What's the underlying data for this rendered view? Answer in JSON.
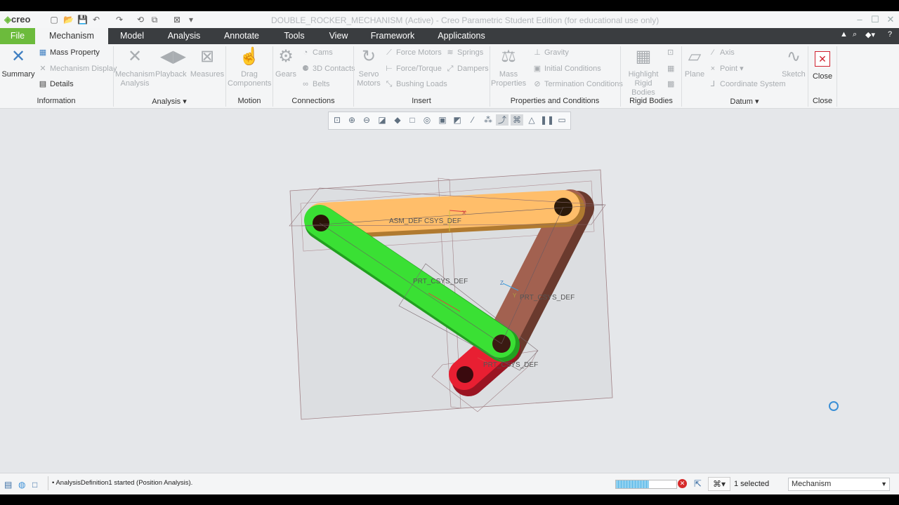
{
  "app": {
    "logo": "creo",
    "window_title": "DOUBLE_ROCKER_MECHANISM (Active) - Creo Parametric Student Edition (for educational use only)"
  },
  "tabs": [
    "File",
    "Mechanism",
    "Model",
    "Analysis",
    "Annotate",
    "Tools",
    "View",
    "Framework",
    "Applications"
  ],
  "ribbon": {
    "information": {
      "group_label": "Information",
      "summary": "Summary",
      "mass_property": "Mass Property",
      "mechanism_display": "Mechanism Display",
      "details": "Details"
    },
    "analysis": {
      "group_label": "Analysis",
      "mechanism_analysis": "Mechanism Analysis",
      "playback": "Playback",
      "measures": "Measures"
    },
    "motion": {
      "group_label": "Motion",
      "drag_components": "Drag Components"
    },
    "connections": {
      "group_label": "Connections",
      "gears": "Gears",
      "cams": "Cams",
      "contacts_3d": "3D Contacts",
      "belts": "Belts"
    },
    "insert": {
      "group_label": "Insert",
      "servo_motors": "Servo Motors",
      "force_motors": "Force Motors",
      "force_torque": "Force/Torque",
      "bushing_loads": "Bushing Loads",
      "springs": "Springs",
      "dampers": "Dampers"
    },
    "properties": {
      "group_label": "Properties and Conditions",
      "mass_properties": "Mass Properties",
      "gravity": "Gravity",
      "initial_conditions": "Initial Conditions",
      "termination_conditions": "Termination Conditions"
    },
    "rigid_bodies": {
      "group_label": "Rigid Bodies",
      "highlight": "Highlight Rigid Bodies"
    },
    "datum": {
      "group_label": "Datum",
      "plane": "Plane",
      "axis": "Axis",
      "point": "Point",
      "coordinate_system": "Coordinate System",
      "sketch": "Sketch"
    },
    "close": {
      "group_label": "Close",
      "close": "Close"
    }
  },
  "model_labels": {
    "top_link": "ASM_DEF CSYS_DEF",
    "green_link": "PRT_CSYS_DEF",
    "brown_link": "PRT_CSYS_DEF",
    "red_link": "PRT_CSYS_DEF",
    "axis_x": "X",
    "axis_y": "Y",
    "axis_z": "Z"
  },
  "status": {
    "message": "AnalysisDefinition1 started (Position Analysis).",
    "selected": "1 selected",
    "filter": "Mechanism",
    "progress": 0.55
  },
  "colors": {
    "file_tab": "#6cbb3c",
    "top_link": "#ffbe6a",
    "green_link": "#3ae034",
    "brown_link": "#a26150",
    "red_link": "#e81f32"
  }
}
